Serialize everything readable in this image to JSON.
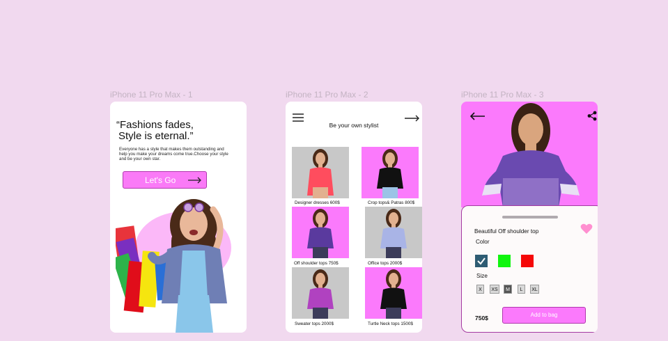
{
  "frames": [
    {
      "label": "iPhone 11 Pro Max - 1"
    },
    {
      "label": "iPhone 11 Pro Max - 2"
    },
    {
      "label": "iPhone 11 Pro Max - 3"
    }
  ],
  "screen1": {
    "quote_line1": "“Fashions fades,",
    "quote_line2": "Style is eternal.”",
    "description": "Everyone has a style that makes them outstanding and help you make your dreams come true.Choose your style and be your own star.",
    "cta_label": "Let's Go",
    "icons": {
      "cta_arrow": "arrow-right-icon"
    }
  },
  "screen2": {
    "title": "Be your own stylist",
    "icons": {
      "menu": "hamburger-menu-icon",
      "next": "arrow-right-icon"
    },
    "products": [
      {
        "caption": "Designer dresses 600$",
        "bg": "#c8c8c8",
        "garment": "#ff4d5e"
      },
      {
        "caption": "Crop tops& Patras 800$",
        "bg": "#fb7afc",
        "garment": "#111111"
      },
      {
        "caption": "Off shoulder tops 750$",
        "bg": "#fb7afc",
        "garment": "#5a3a9e"
      },
      {
        "caption": "Office tops 2000$",
        "bg": "#c8c8c8",
        "garment": "#a9b4e6"
      },
      {
        "caption": "Sweater tops 2000$",
        "bg": "#c8c8c8",
        "garment": "#b042c0"
      },
      {
        "caption": "Turtle Neck tops 1500$",
        "bg": "#fb7afc",
        "garment": "#111111"
      }
    ]
  },
  "screen3": {
    "product_title": "Beautiful Off shoulder top",
    "color_label": "Color",
    "colors": [
      "#2e5c73",
      "#11f50f",
      "#f50808"
    ],
    "size_label": "Size",
    "sizes": [
      "X",
      "XS",
      "M",
      "L",
      "XL"
    ],
    "selected_size": "M",
    "price": "750$",
    "add_to_bag_label": "Add to bag",
    "icons": {
      "back": "arrow-left-icon",
      "share": "share-icon",
      "favorite": "heart-icon"
    }
  },
  "colors": {
    "background": "#f1d9ef",
    "accent": "#fb7afc",
    "accent_border": "#b037ad"
  }
}
